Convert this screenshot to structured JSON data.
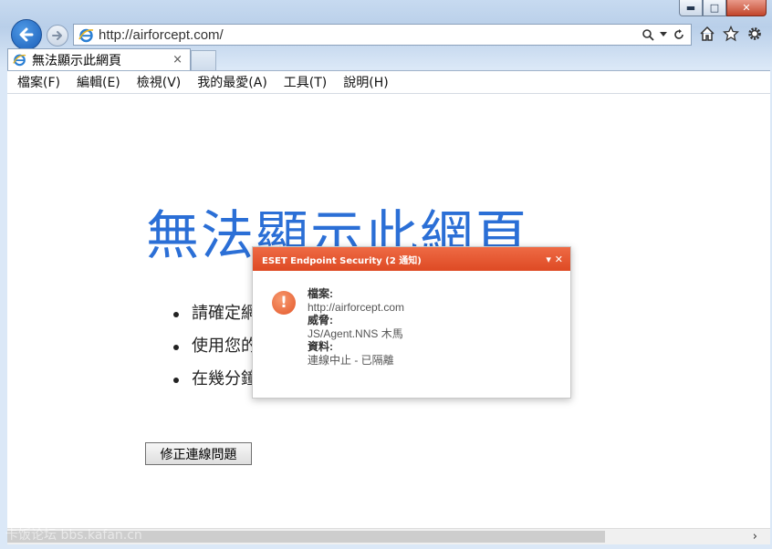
{
  "browser": {
    "address": "http://airforcept.com/",
    "tab_title": "無法顯示此網頁",
    "tab_close": "×",
    "menu": [
      "檔案(F)",
      "編輯(E)",
      "檢視(V)",
      "我的最愛(A)",
      "工具(T)",
      "說明(H)"
    ],
    "window_controls": {
      "minimize": "▬",
      "maximize": "□",
      "close": "✕"
    }
  },
  "page": {
    "title": "無法顯示此網頁",
    "bullets": [
      "請確定網址 http://airforcept.com 是正確的。",
      "使用您的搜尋引擎尋找網頁。",
      "在幾分鐘後重新整理網頁。"
    ],
    "fix_button": "修正連線問題"
  },
  "eset_notification": {
    "header": "ESET Endpoint Security (2 通知)",
    "controls": "▾ ✕",
    "icon": "!",
    "file_label": "檔案:",
    "file_value": "http://airforcept.com",
    "threat_label": "威脅:",
    "threat_value": "JS/Agent.NNS 木馬",
    "info_label": "資料:",
    "info_value": "連線中止 - 已隔離",
    "accent_color": "#e4572a"
  },
  "watermark": "卡饭论坛 bbs.kafan.cn",
  "scroll": {
    "right_arrow": "›"
  },
  "icons": [
    "back-arrow-icon",
    "forward-arrow-icon",
    "ie-logo-icon",
    "search-icon",
    "refresh-icon",
    "home-icon",
    "favorites-star-icon",
    "gear-icon"
  ]
}
